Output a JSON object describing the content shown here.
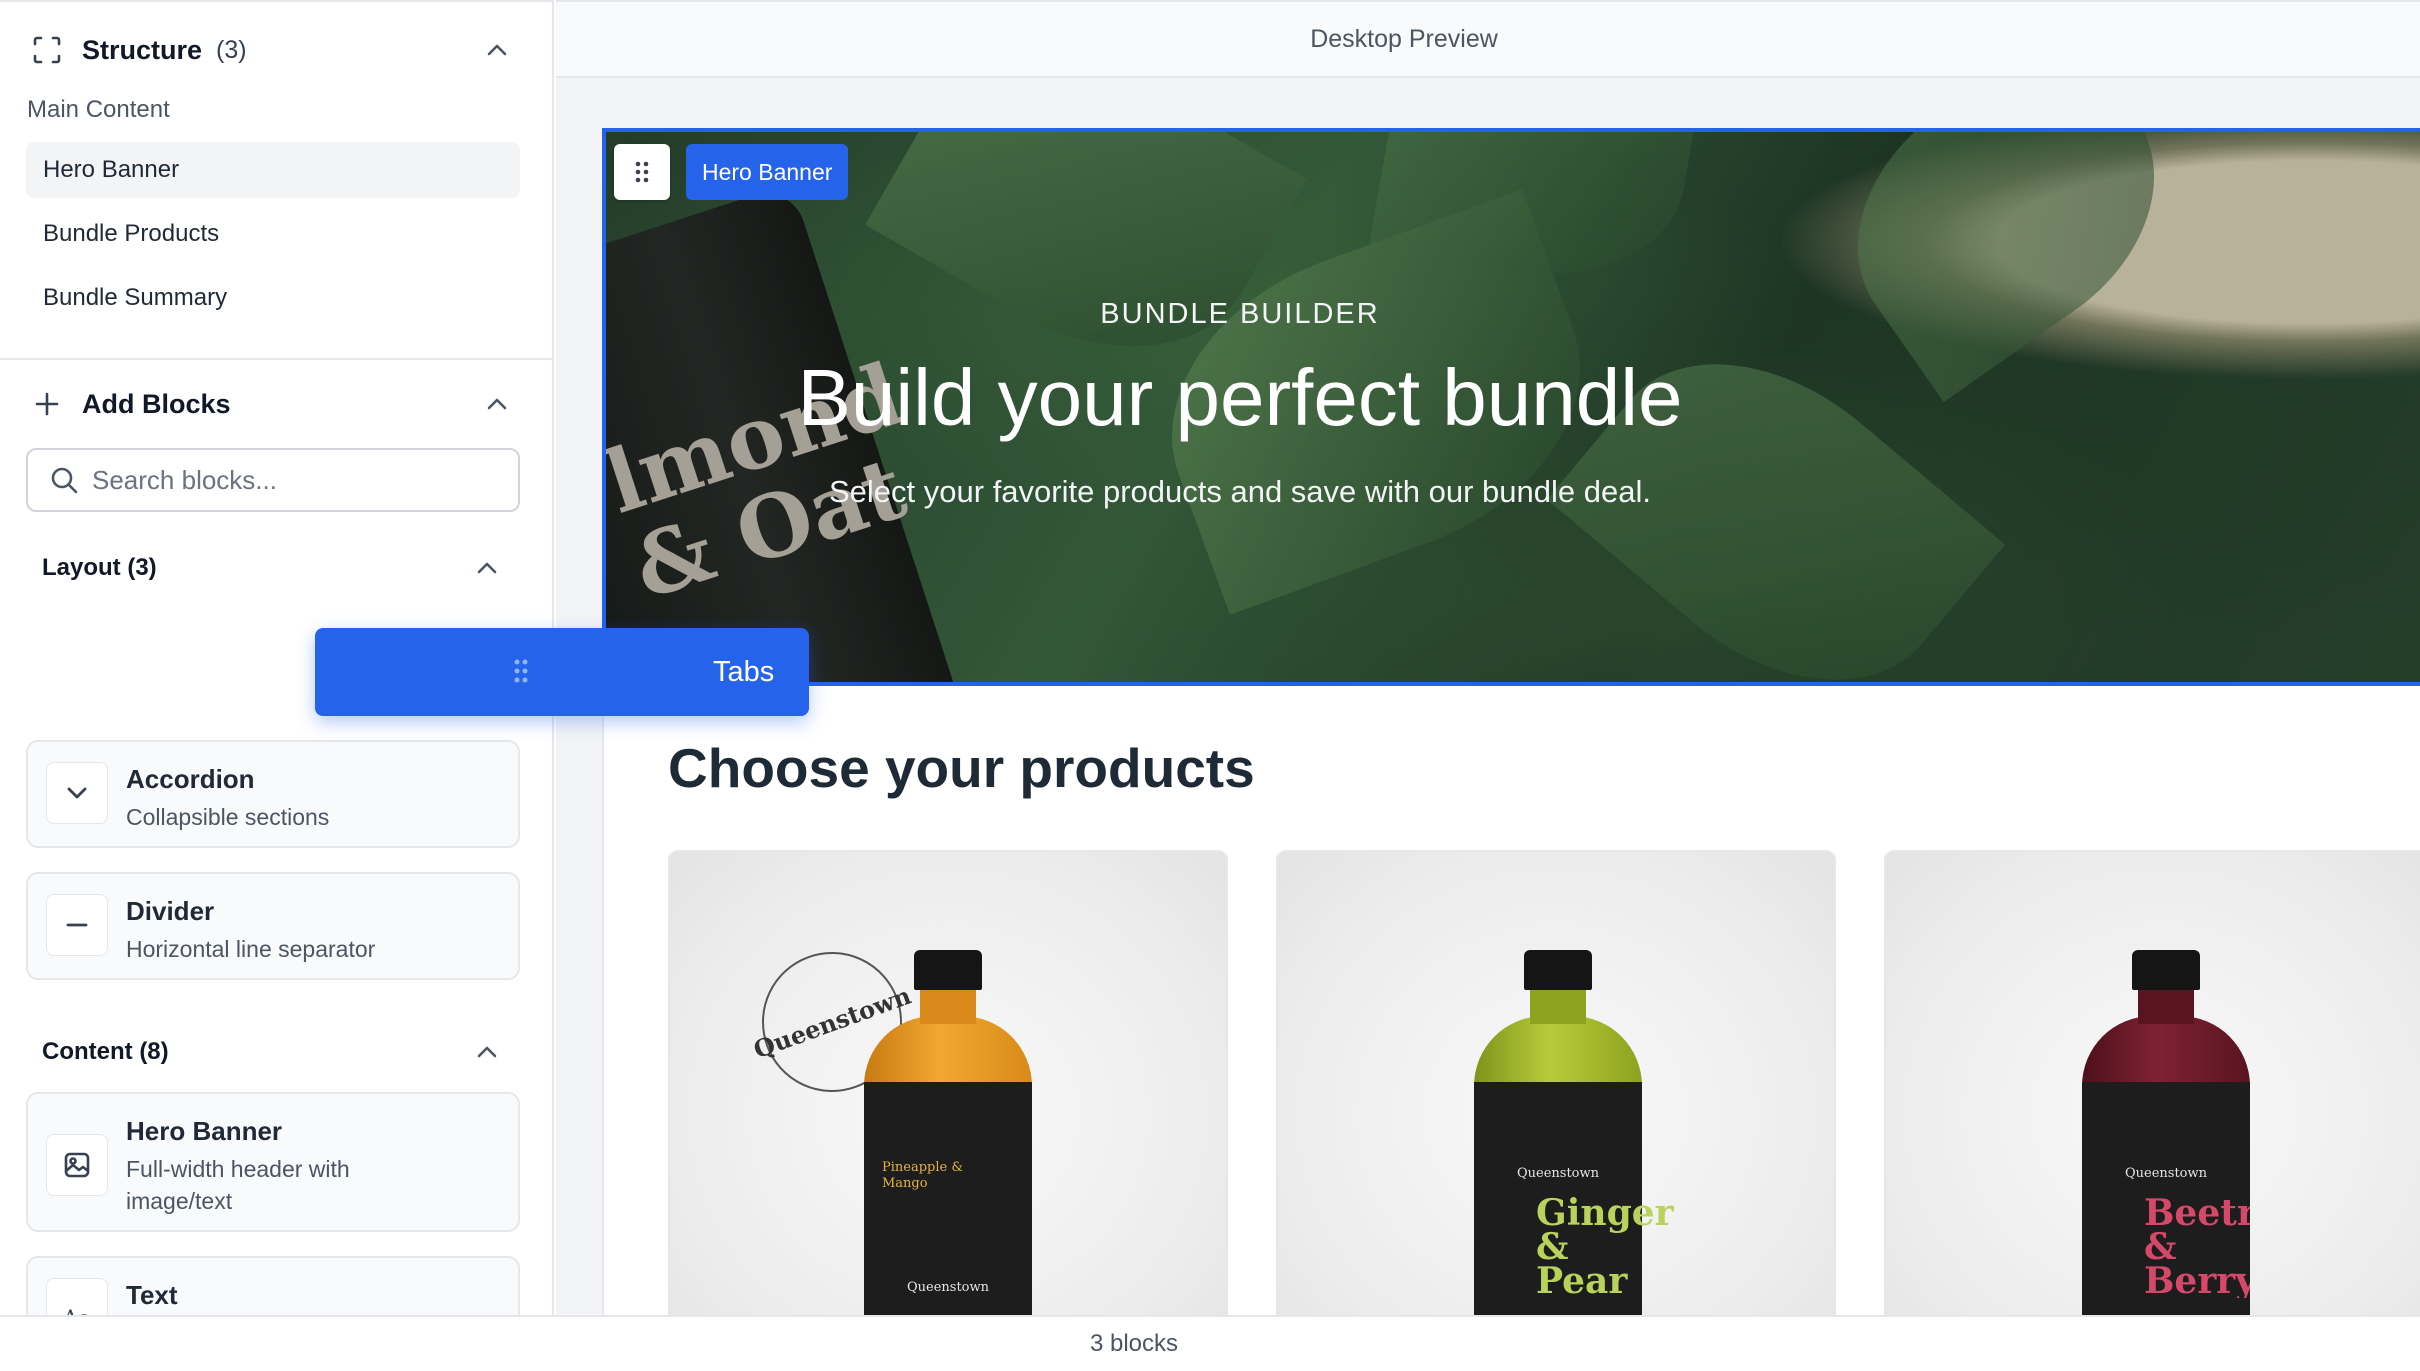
{
  "sidebar": {
    "structure": {
      "title": "Structure",
      "count": "(3)"
    },
    "group_label": "Main Content",
    "tree_items": [
      "Hero Banner",
      "Bundle Products",
      "Bundle Summary"
    ],
    "add_blocks": {
      "title": "Add Blocks"
    },
    "search": {
      "placeholder": "Search blocks..."
    },
    "layout_category": {
      "label": "Layout (3)"
    },
    "content_category": {
      "label": "Content (8)"
    },
    "drag_ghost": {
      "label": "Tabs"
    },
    "layout_blocks": [
      {
        "title": "Accordion",
        "desc": "Collapsible sections",
        "icon": "chevron-down-icon"
      },
      {
        "title": "Divider",
        "desc": "Horizontal line separator",
        "icon": "minus-icon"
      }
    ],
    "content_blocks": [
      {
        "title": "Hero Banner",
        "desc": "Full-width header with image/text",
        "icon": "image-icon"
      },
      {
        "title": "Text",
        "desc": "",
        "icon": "text-icon"
      }
    ],
    "active_item": "Hero Banner"
  },
  "preview": {
    "bar_title": "Desktop Preview",
    "hero": {
      "tag": "Hero Banner",
      "eyebrow": "BUNDLE BUILDER",
      "title": "Build your perfect bundle",
      "subtitle": "Select your favorite products and save with our bundle deal.",
      "bg_bottle_text": "lmond\n& Oat"
    },
    "products_title": "Choose your products",
    "products": [
      {
        "brand": "Queenstown",
        "flavor": "Pineapple & Mango",
        "body_color": "#e89a22",
        "label_text_color": "#e6b341"
      },
      {
        "brand": "Queenstown",
        "flavor": "Ginger & Pear",
        "body_color": "#9fb52a",
        "label_text_color": "#b9d35a"
      },
      {
        "brand": "Queenstown",
        "flavor": "Beetroot & Berry",
        "body_color": "#6e1a28",
        "label_text_color": "#d6486a"
      }
    ],
    "stamp_text": "Queenstown"
  },
  "footer": {
    "status": "3 blocks"
  },
  "colors": {
    "accent": "#2563eb",
    "sidebar_active": "#f3f4f6",
    "border": "#e5e7eb"
  }
}
